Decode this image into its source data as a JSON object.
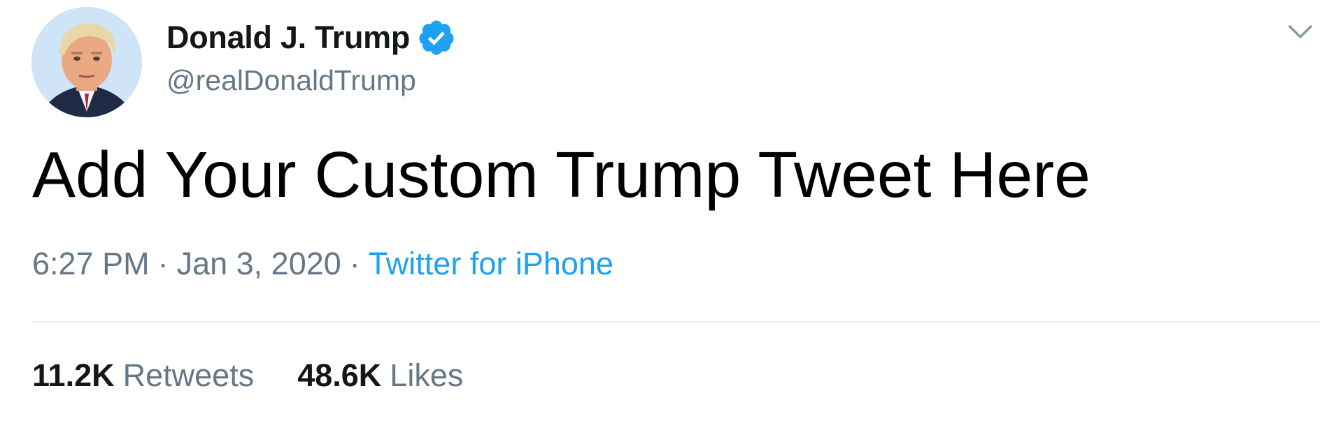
{
  "tweet": {
    "author": {
      "display_name": "Donald J. Trump",
      "handle": "@realDonaldTrump",
      "verified": true,
      "verified_icon": "verified-badge-icon",
      "avatar_icon": "profile-avatar"
    },
    "text": "Add Your Custom Trump Tweet Here",
    "meta": {
      "time": "6:27 PM",
      "separator": "·",
      "date": "Jan 3, 2020",
      "source": "Twitter for iPhone"
    },
    "stats": {
      "retweets_count": "11.2K",
      "retweets_label": "Retweets",
      "likes_count": "48.6K",
      "likes_label": "Likes"
    },
    "menu_icon": "chevron-down-icon"
  },
  "colors": {
    "text_primary": "#14171a",
    "text_secondary": "#657786",
    "link": "#1da1f2",
    "divider": "#e6ecf0"
  }
}
